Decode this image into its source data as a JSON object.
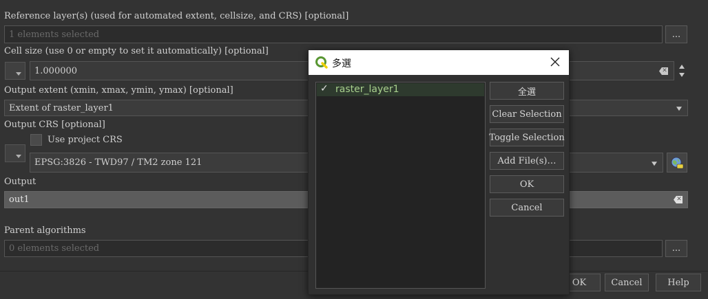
{
  "form": {
    "reference_layers_label": "Reference layer(s) (used for automated extent, cellsize, and CRS) [optional]",
    "reference_layers_value": "1 elements selected",
    "cell_size_label": "Cell size (use 0 or empty to set it automatically) [optional]",
    "cell_size_value": "1.000000",
    "output_extent_label": "Output extent (xmin, xmax, ymin, ymax) [optional]",
    "output_extent_value": "Extent of raster_layer1",
    "output_crs_label": "Output CRS [optional]",
    "use_project_crs_label": "Use project CRS",
    "crs_value": "EPSG:3826 - TWD97 / TM2 zone 121",
    "output_label": "Output",
    "output_value": "out1",
    "parent_algorithms_label": "Parent algorithms",
    "parent_algorithms_value": "0 elements selected",
    "browse_label": "..."
  },
  "footer": {
    "ok_label": "OK",
    "cancel_label": "Cancel",
    "help_label": "Help"
  },
  "dialog": {
    "title": "多選",
    "items": [
      {
        "label": "raster_layer1",
        "checked": true
      }
    ],
    "buttons": {
      "select_all": "全選",
      "clear_selection": "Clear Selection",
      "toggle_selection": "Toggle Selection",
      "add_files": "Add File(s)…",
      "ok": "OK",
      "cancel": "Cancel"
    }
  },
  "colors": {
    "background": "#333333",
    "qgis_green": "#589632",
    "qgis_yellow": "#f0d000"
  }
}
